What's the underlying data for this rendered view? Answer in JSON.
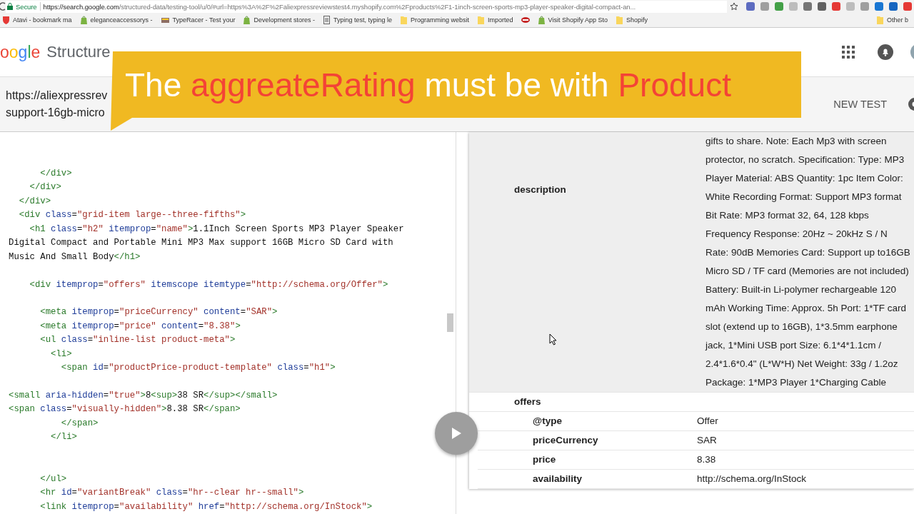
{
  "browser": {
    "secure_label": "Secure",
    "url_host": "https://search.google.com",
    "url_path": "/structured-data/testing-tool/u/0/#url=https%3A%2F%2Faliexpressreviewstest4.myshopify.com%2Fproducts%2F1-1inch-screen-sports-mp3-player-speaker-digital-compact-an...",
    "bookmarks": [
      {
        "kind": "shield",
        "label": "Atavi - bookmark ma"
      },
      {
        "kind": "bag",
        "label": "eleganceaccessorys -"
      },
      {
        "kind": "keyboard",
        "label": "TypeRacer - Test your"
      },
      {
        "kind": "bag",
        "label": "Development stores -"
      },
      {
        "kind": "page",
        "label": "Typing test, typing le"
      },
      {
        "kind": "folder",
        "label": "Programming websit"
      },
      {
        "kind": "folder",
        "label": "Imported"
      },
      {
        "kind": "lips"
      },
      {
        "kind": "bag",
        "label": "Visit Shopify App Sto"
      },
      {
        "kind": "folder",
        "label": "Shopify"
      }
    ],
    "other_bookmarks": {
      "kind": "folder",
      "label": "Other b"
    }
  },
  "header": {
    "logo_text": "oogle",
    "product_title": "Structure"
  },
  "test_bar": {
    "url_lines": [
      "https://aliexpressrev",
      "support-16gb-micro"
    ],
    "new_test": "NEW TEST"
  },
  "banner": {
    "segments": [
      {
        "text": "The ",
        "highlight": false
      },
      {
        "text": "aggreateRating",
        "highlight": true
      },
      {
        "text": " must be with ",
        "highlight": false
      },
      {
        "text": "Product",
        "highlight": true
      }
    ]
  },
  "code": {
    "lines": [
      {
        "kind": "code",
        "tokens": [
          {
            "kind": "tag",
            "text": "      </div>"
          }
        ]
      },
      {
        "kind": "code",
        "tokens": [
          {
            "kind": "tag",
            "text": "    </div>"
          }
        ]
      },
      {
        "kind": "code",
        "tokens": [
          {
            "kind": "tag",
            "text": "  </div>"
          }
        ]
      },
      {
        "kind": "code",
        "tokens": [
          {
            "kind": "tag",
            "text": "  <div"
          },
          {
            "kind": "attr",
            "text": " class"
          },
          {
            "kind": "text",
            "text": "="
          },
          {
            "kind": "value",
            "text": "\"grid-item large--three-fifths\""
          },
          {
            "kind": "tag",
            "text": ">"
          }
        ]
      },
      {
        "kind": "code",
        "tokens": [
          {
            "kind": "tag",
            "text": "    <h1"
          },
          {
            "kind": "attr",
            "text": " class"
          },
          {
            "kind": "text",
            "text": "="
          },
          {
            "kind": "value",
            "text": "\"h2\""
          },
          {
            "kind": "attr",
            "text": " itemprop"
          },
          {
            "kind": "text",
            "text": "="
          },
          {
            "kind": "value",
            "text": "\"name\""
          },
          {
            "kind": "tag",
            "text": ">"
          },
          {
            "kind": "text",
            "text": "1.1Inch Screen Sports MP3 Player Speaker"
          }
        ]
      },
      {
        "kind": "code",
        "tokens": [
          {
            "kind": "text",
            "text": "Digital Compact and Portable Mini MP3 Max support 16GB Micro SD Card with"
          }
        ]
      },
      {
        "kind": "code",
        "tokens": [
          {
            "kind": "text",
            "text": "Music And Small Body"
          },
          {
            "kind": "tag",
            "text": "</h1>"
          }
        ]
      },
      {
        "kind": "blank"
      },
      {
        "kind": "code",
        "tokens": [
          {
            "kind": "tag",
            "text": "    <div"
          },
          {
            "kind": "attr",
            "text": " itemprop"
          },
          {
            "kind": "text",
            "text": "="
          },
          {
            "kind": "value",
            "text": "\"offers\""
          },
          {
            "kind": "attr",
            "text": " itemscope itemtype"
          },
          {
            "kind": "text",
            "text": "="
          },
          {
            "kind": "value",
            "text": "\"http://schema.org/Offer\""
          },
          {
            "kind": "tag",
            "text": ">"
          }
        ]
      },
      {
        "kind": "blank"
      },
      {
        "kind": "code",
        "tokens": [
          {
            "kind": "tag",
            "text": "      <meta"
          },
          {
            "kind": "attr",
            "text": " itemprop"
          },
          {
            "kind": "text",
            "text": "="
          },
          {
            "kind": "value",
            "text": "\"priceCurrency\""
          },
          {
            "kind": "attr",
            "text": " content"
          },
          {
            "kind": "text",
            "text": "="
          },
          {
            "kind": "value",
            "text": "\"SAR\""
          },
          {
            "kind": "tag",
            "text": ">"
          }
        ]
      },
      {
        "kind": "code",
        "tokens": [
          {
            "kind": "tag",
            "text": "      <meta"
          },
          {
            "kind": "attr",
            "text": " itemprop"
          },
          {
            "kind": "text",
            "text": "="
          },
          {
            "kind": "value",
            "text": "\"price\""
          },
          {
            "kind": "attr",
            "text": " content"
          },
          {
            "kind": "text",
            "text": "="
          },
          {
            "kind": "value",
            "text": "\"8.38\""
          },
          {
            "kind": "tag",
            "text": ">"
          }
        ]
      },
      {
        "kind": "code",
        "tokens": [
          {
            "kind": "tag",
            "text": "      <ul"
          },
          {
            "kind": "attr",
            "text": " class"
          },
          {
            "kind": "text",
            "text": "="
          },
          {
            "kind": "value",
            "text": "\"inline-list product-meta\""
          },
          {
            "kind": "tag",
            "text": ">"
          }
        ]
      },
      {
        "kind": "code",
        "tokens": [
          {
            "kind": "tag",
            "text": "        <li>"
          }
        ]
      },
      {
        "kind": "code",
        "tokens": [
          {
            "kind": "tag",
            "text": "          <span"
          },
          {
            "kind": "attr",
            "text": " id"
          },
          {
            "kind": "text",
            "text": "="
          },
          {
            "kind": "value",
            "text": "\"productPrice-product-template\""
          },
          {
            "kind": "attr",
            "text": " class"
          },
          {
            "kind": "text",
            "text": "="
          },
          {
            "kind": "value",
            "text": "\"h1\""
          },
          {
            "kind": "tag",
            "text": ">"
          }
        ]
      },
      {
        "kind": "blank"
      },
      {
        "kind": "code",
        "tokens": [
          {
            "kind": "tag",
            "text": "<small"
          },
          {
            "kind": "attr",
            "text": " aria-hidden"
          },
          {
            "kind": "text",
            "text": "="
          },
          {
            "kind": "value",
            "text": "\"true\""
          },
          {
            "kind": "tag",
            "text": ">"
          },
          {
            "kind": "text",
            "text": "8"
          },
          {
            "kind": "tag",
            "text": "<sup>"
          },
          {
            "kind": "text",
            "text": "38 SR"
          },
          {
            "kind": "tag",
            "text": "</sup></small>"
          }
        ]
      },
      {
        "kind": "code",
        "tokens": [
          {
            "kind": "tag",
            "text": "<span"
          },
          {
            "kind": "attr",
            "text": " class"
          },
          {
            "kind": "text",
            "text": "="
          },
          {
            "kind": "value",
            "text": "\"visually-hidden\""
          },
          {
            "kind": "tag",
            "text": ">"
          },
          {
            "kind": "text",
            "text": "8.38 SR"
          },
          {
            "kind": "tag",
            "text": "</span>"
          }
        ]
      },
      {
        "kind": "code",
        "tokens": [
          {
            "kind": "tag",
            "text": "          </span>"
          }
        ]
      },
      {
        "kind": "code",
        "tokens": [
          {
            "kind": "tag",
            "text": "        </li>"
          }
        ]
      },
      {
        "kind": "blank"
      },
      {
        "kind": "blank"
      },
      {
        "kind": "code",
        "tokens": [
          {
            "kind": "tag",
            "text": "      </ul>"
          }
        ]
      },
      {
        "kind": "code",
        "tokens": [
          {
            "kind": "tag",
            "text": "      <hr"
          },
          {
            "kind": "attr",
            "text": " id"
          },
          {
            "kind": "text",
            "text": "="
          },
          {
            "kind": "value",
            "text": "\"variantBreak\""
          },
          {
            "kind": "attr",
            "text": " class"
          },
          {
            "kind": "text",
            "text": "="
          },
          {
            "kind": "value",
            "text": "\"hr--clear hr--small\""
          },
          {
            "kind": "tag",
            "text": ">"
          }
        ]
      },
      {
        "kind": "code",
        "tokens": [
          {
            "kind": "tag",
            "text": "      <link"
          },
          {
            "kind": "attr",
            "text": " itemprop"
          },
          {
            "kind": "text",
            "text": "="
          },
          {
            "kind": "value",
            "text": "\"availability\""
          },
          {
            "kind": "attr",
            "text": " href"
          },
          {
            "kind": "text",
            "text": "="
          },
          {
            "kind": "value",
            "text": "\"http://schema.org/InStock\""
          },
          {
            "kind": "tag",
            "text": ">"
          }
        ]
      }
    ]
  },
  "result": {
    "rows": [
      {
        "label": "description",
        "selected": true,
        "value": "gifts to share. Note: Each Mp3 with screen protector, no scratch. Specification: Type: MP3 Player Material: ABS Quantity: 1pc Item Color: White Recording Format: Support MP3 format Bit Rate: MP3 format 32, 64, 128 kbps Frequency Response: 20Hz ~ 20kHz S / N Rate: 90dB Memories Card: Support up to16GB Micro SD / TF card (Memories are not included) Battery: Built-in Li-polymer rechargeable 120 mAh Working Time: Approx. 5h Port: 1*TF card slot (extend up to 16GB), 1*3.5mm earphone jack, 1*Mini USB port Size: 6.1*4*1.1cm / 2.4*1.6*0.4\" (L*W*H) Net Weight: 33g / 1.2oz Package: 1*MP3 Player 1*Charging Cable"
      },
      {
        "label": "offers",
        "selected": false,
        "children": [
          {
            "label": "@type",
            "value": "Offer",
            "selected": false
          },
          {
            "label": "priceCurrency",
            "value": "SAR",
            "selected": false
          },
          {
            "label": "price",
            "value": "8.38",
            "selected": false
          },
          {
            "label": "availability",
            "value": "http://schema.org/InStock",
            "selected": false
          }
        ]
      }
    ]
  }
}
